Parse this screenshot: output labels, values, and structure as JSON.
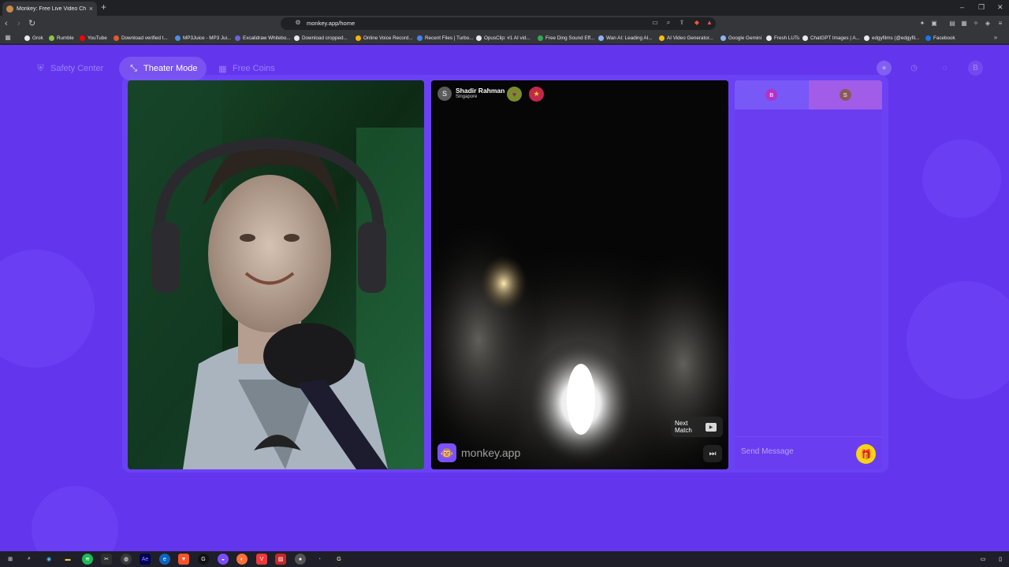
{
  "browser": {
    "tab_title": "Monkey: Free Live Video Chat",
    "url": "monkey.app/home",
    "new_tab_icon": "plus-icon",
    "window_controls": [
      "–",
      "❐",
      "✕"
    ],
    "bookmarks": [
      {
        "label": "Grok",
        "color": "#e8eaed"
      },
      {
        "label": "Rumble",
        "color": "#85c742"
      },
      {
        "label": "YouTube",
        "color": "#ff0000"
      },
      {
        "label": "Download verified t...",
        "color": "#e05b2b"
      },
      {
        "label": "MP3Juice - MP3 Jui...",
        "color": "#4a8fe7"
      },
      {
        "label": "Excalidraw Whitebo...",
        "color": "#6965db"
      },
      {
        "label": "Download cropped...",
        "color": "#e8eaed"
      },
      {
        "label": "Online Voice Record...",
        "color": "#f4b400"
      },
      {
        "label": "Recent Files | Turbo...",
        "color": "#4285f4"
      },
      {
        "label": "OpusClip: #1 AI vid...",
        "color": "#e8eaed"
      },
      {
        "label": "Free Ding Sound Eff...",
        "color": "#34a853"
      },
      {
        "label": "Wan AI: Leading AI...",
        "color": "#8ab4f8"
      },
      {
        "label": "AI Video Generator...",
        "color": "#fbbc04"
      },
      {
        "label": "Google Gemini",
        "color": "#8ab4f8"
      },
      {
        "label": "Fresh LUTs",
        "color": "#e8eaed"
      },
      {
        "label": "ChatGPT Images | A...",
        "color": "#e8eaed"
      },
      {
        "label": "edgyfilms (@edgyfil...",
        "color": "#e8eaed"
      },
      {
        "label": "Facebook",
        "color": "#1877f2"
      }
    ]
  },
  "nav": {
    "safety_center": "Safety Center",
    "theater_mode": "Theater Mode",
    "free_coins": "Free Coins",
    "user_initial": "B"
  },
  "remote": {
    "initial": "S",
    "name": "Shadir Rahman",
    "location": "Singapore",
    "brand": "monkey.app",
    "next_match": "Next Match",
    "next_key": "▶"
  },
  "chat": {
    "tab1_initial": "B",
    "tab2_initial": "S",
    "placeholder": "Send Message"
  },
  "colors": {
    "page_bg": "#6336ee",
    "chat_bg": "#6a3ef0",
    "gift": "#f6d415"
  }
}
